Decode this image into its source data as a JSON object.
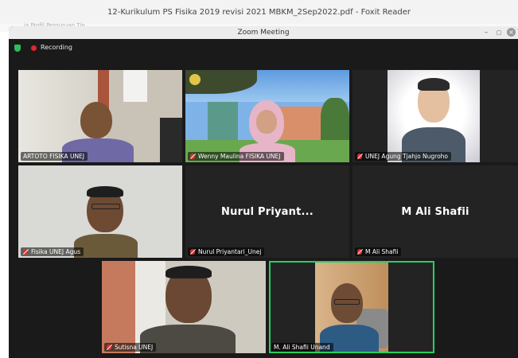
{
  "background_app": {
    "title": "12-Kurikulum PS Fisika 2019 revisi 2021 MBKM_2Sep2022.pdf - Foxit Reader",
    "ghost_tab": "ia    Profil Perguruan Tin"
  },
  "zoom": {
    "window_title": "Zoom Meeting",
    "minimize": "–",
    "maximize": "▢",
    "close": "×",
    "recording_label": "Recording"
  },
  "tiles": [
    {
      "name": "ARTOTO FISIKA UNEJ",
      "muted": false
    },
    {
      "name": "Wenny Maulina FISIKA UNEJ",
      "muted": true
    },
    {
      "name": "UNEJ Agung Tjahjo Nugroho",
      "muted": true
    },
    {
      "name": "Fisika UNEJ Agus",
      "muted": true
    },
    {
      "name": "Nurul Priyantari_Unej",
      "muted": true,
      "display_name": "Nurul Priyant..."
    },
    {
      "name": "M Ali Shafii",
      "muted": true,
      "display_name": "M Ali Shafii"
    },
    {
      "name": "Sutisna UNEJ",
      "muted": true
    },
    {
      "name": "M. Ali Shafii Unand",
      "muted": false,
      "active_speaker": true
    }
  ],
  "colors": {
    "active_border": "#23d160",
    "muted_icon": "#e03030",
    "recording_dot": "#e02828"
  }
}
